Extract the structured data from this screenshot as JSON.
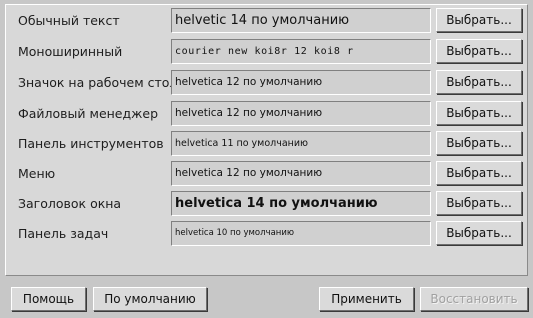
{
  "font_rows": [
    {
      "label": "Обычный текст",
      "value": "helvetic 14 по умолчанию",
      "button": "Выбрать..."
    },
    {
      "label": "Моноширинный",
      "value": "courier new koi8r 12 koi8 r",
      "button": "Выбрать..."
    },
    {
      "label": "Значок на рабочем столе",
      "value": "helvetica 12 по умолчанию",
      "button": "Выбрать..."
    },
    {
      "label": "Файловый менеджер",
      "value": "helvetica 12 по умолчанию",
      "button": "Выбрать..."
    },
    {
      "label": "Панель инструментов",
      "value": "helvetica 11 по умолчанию",
      "button": "Выбрать..."
    },
    {
      "label": "Меню",
      "value": "helvetica 12 по умолчанию",
      "button": "Выбрать..."
    },
    {
      "label": "Заголовок окна",
      "value": "helvetica 14 по умолчанию",
      "button": "Выбрать..."
    },
    {
      "label": "Панель задач",
      "value": "helvetica 10 по умолчанию",
      "button": "Выбрать..."
    }
  ],
  "buttons": {
    "help": "Помощь",
    "defaults": "По умолчанию",
    "apply": "Применить",
    "revert": "Восстановить"
  }
}
